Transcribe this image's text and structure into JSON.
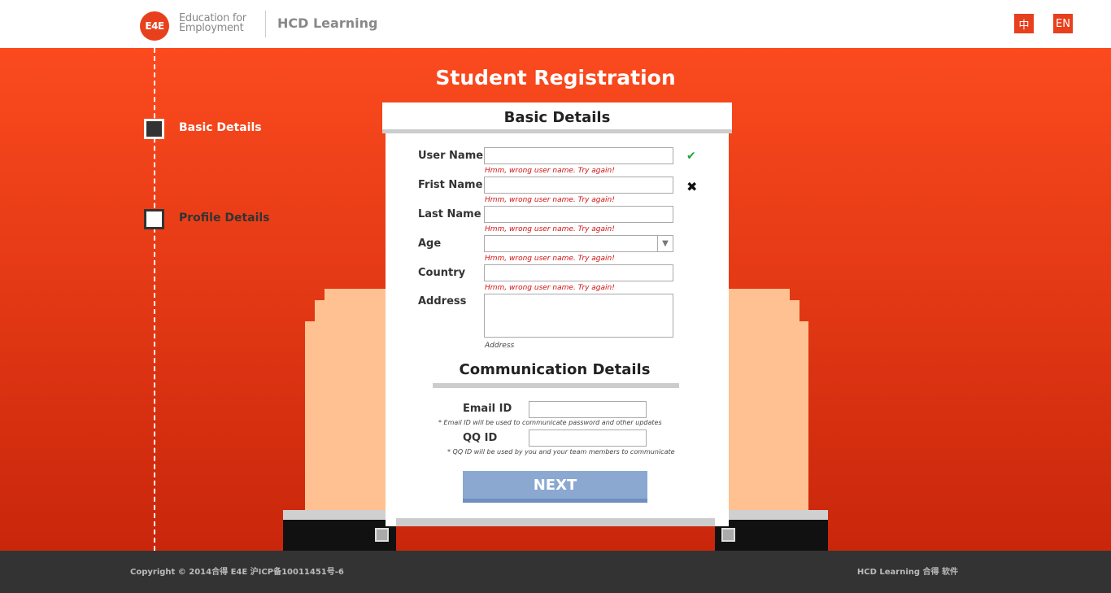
{
  "header": {
    "logo_mark": "E4E",
    "logo_line1": "Education for",
    "logo_line2": "Employment",
    "brand": "HCD Learning",
    "lang_zh": "中",
    "lang_en": "EN"
  },
  "steps": [
    {
      "label": "Basic Details",
      "active": true
    },
    {
      "label": "Profile Details",
      "active": false
    }
  ],
  "page_title": "Student Registration",
  "basic": {
    "title": "Basic Details",
    "fields": [
      {
        "label": "User Name",
        "value": "",
        "error": "Hmm, wrong user name. Try again!",
        "status": "valid"
      },
      {
        "label": "Frist Name",
        "value": "",
        "error": "Hmm, wrong user name. Try again!",
        "status": "invalid"
      },
      {
        "label": "Last Name",
        "value": "",
        "error": "Hmm, wrong user name. Try again!"
      },
      {
        "label": "Age",
        "value": "",
        "error": "Hmm, wrong user name. Try again!"
      },
      {
        "label": "Country",
        "value": "",
        "error": "Hmm, wrong user name. Try again!"
      },
      {
        "label": "Address",
        "value": "",
        "hint": "Address"
      }
    ],
    "valid_icon": "check-icon",
    "invalid_icon": "cross-icon"
  },
  "communication": {
    "title": "Communication Details",
    "email_label": "Email ID",
    "email_value": "",
    "email_note": "* Email ID will be used to communicate password and other updates",
    "qq_label": "QQ ID",
    "qq_value": "",
    "qq_note": "* QQ ID will be used by you and your team members to communicate"
  },
  "next_label": "NEXT",
  "footer": {
    "copyright": "Copyright © 2014合得 E4E 沪ICP备10011451号-6",
    "brand": "HCD Learning 合得 软件"
  },
  "colors": {
    "accent": "#e8401c",
    "button": "#8aa8d0",
    "error": "#d01010",
    "valid": "#1ea53a"
  }
}
